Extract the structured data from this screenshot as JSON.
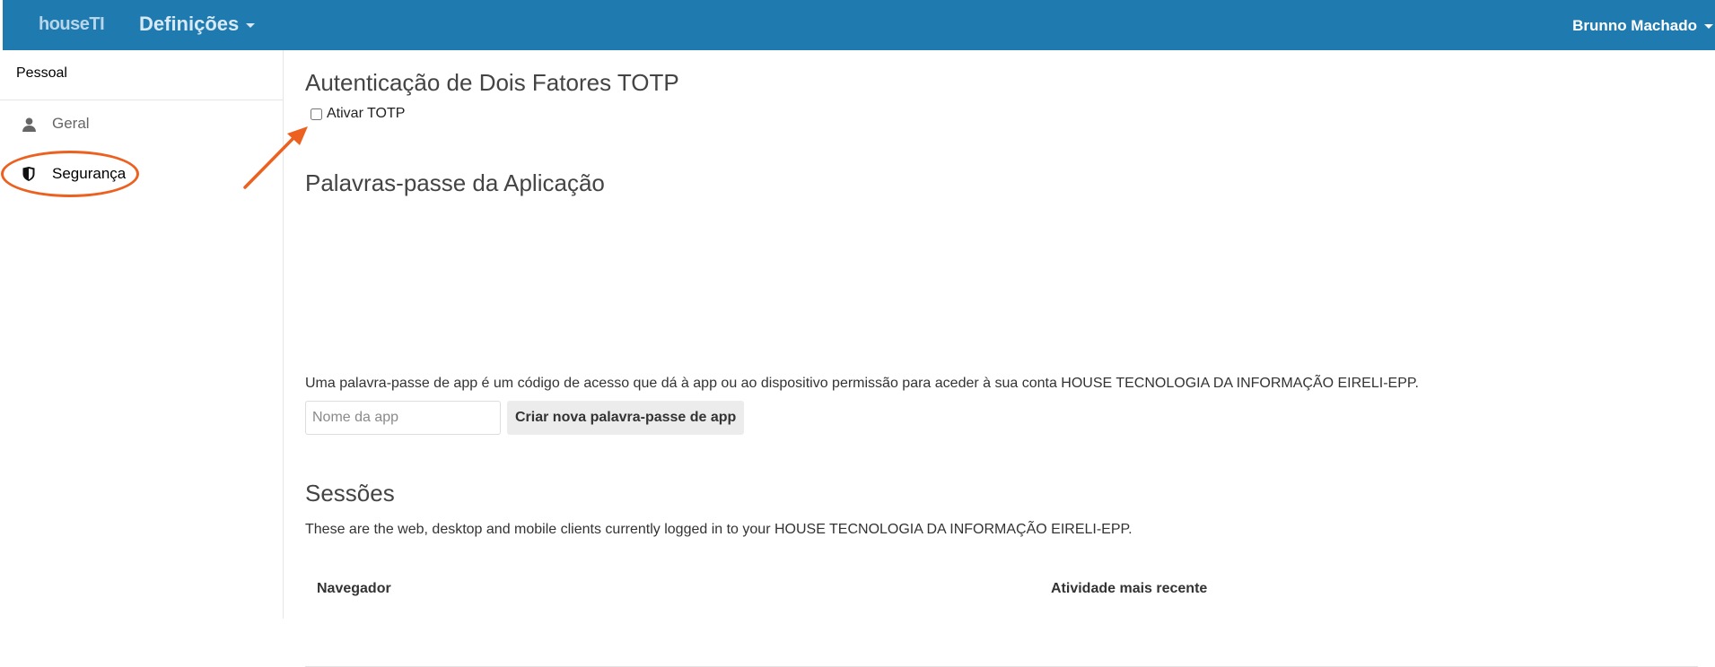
{
  "header": {
    "logo": "houseTI",
    "menu_label": "Definições",
    "user_name": "Brunno Machado",
    "bg_color": "#1f7aaf"
  },
  "sidebar": {
    "section_title": "Pessoal",
    "items": [
      {
        "label": "Geral",
        "icon": "user-icon"
      },
      {
        "label": "Segurança",
        "icon": "shield-icon",
        "active": true
      }
    ]
  },
  "annotation": {
    "color": "#ec611f"
  },
  "totp": {
    "title": "Autenticação de Dois Fatores TOTP",
    "checkbox_label": "Ativar TOTP",
    "checked": false
  },
  "app_passwords": {
    "title": "Palavras-passe da Aplicação",
    "description": "Uma palavra-passe de app é um código de acesso que dá à app ou ao dispositivo permissão para aceder à sua conta HOUSE TECNOLOGIA DA INFORMAÇÃO EIRELI-EPP.",
    "input_placeholder": "Nome da app",
    "input_value": "",
    "button_label": "Criar nova palavra-passe de app"
  },
  "sessions": {
    "title": "Sessões",
    "description": "These are the web, desktop and mobile clients currently logged in to your HOUSE TECNOLOGIA DA INFORMAÇÃO EIRELI-EPP.",
    "columns": [
      "Navegador",
      "Atividade mais recente"
    ]
  }
}
